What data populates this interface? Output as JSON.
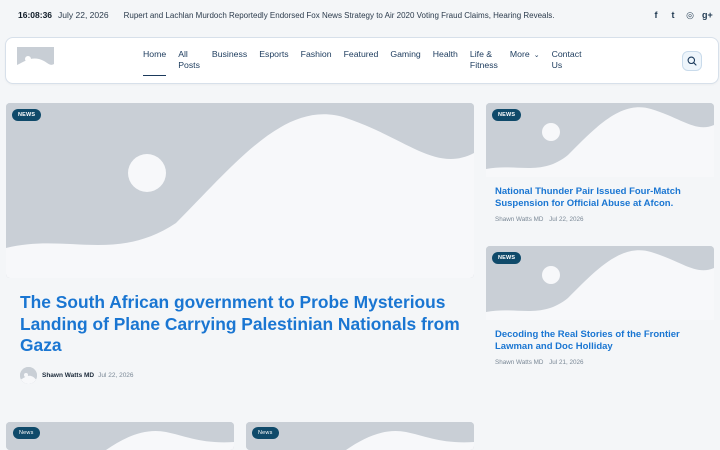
{
  "topbar": {
    "time": "16:08:36",
    "date": "July 22, 2026",
    "ticker": "Rupert and Lachlan Murdoch Reportedly Endorsed Fox News Strategy to Air 2020 Voting Fraud Claims, Hearing Reveals.",
    "social": [
      {
        "icon": "facebook-icon",
        "glyph": "f"
      },
      {
        "icon": "twitter-icon",
        "glyph": "t"
      },
      {
        "icon": "instagram-icon",
        "glyph": "◎"
      },
      {
        "icon": "google-plus-icon",
        "glyph": "g+"
      }
    ]
  },
  "header": {
    "nav": [
      {
        "label": "Home",
        "line2": ""
      },
      {
        "label": "All",
        "line2": "Posts"
      },
      {
        "label": "Business",
        "line2": ""
      },
      {
        "label": "Esports",
        "line2": ""
      },
      {
        "label": "Fashion",
        "line2": ""
      },
      {
        "label": "Featured",
        "line2": ""
      },
      {
        "label": "Gaming",
        "line2": ""
      },
      {
        "label": "Health",
        "line2": ""
      },
      {
        "label": "Life &",
        "line2": "Fitness"
      },
      {
        "label": "More",
        "line2": ""
      },
      {
        "label": "Contact",
        "line2": "Us"
      }
    ]
  },
  "featured": {
    "badge": "NEWS",
    "title": "The South African government to Probe Mysterious Landing of Plane Carrying Palestinian Nationals from Gaza",
    "author": "Shawn Watts MD",
    "date": "Jul 22, 2026"
  },
  "side": [
    {
      "badge": "NEWS",
      "title": "National Thunder Pair Issued Four-Match Suspension for Official Abuse at Afcon.",
      "author": "Shawn Watts MD",
      "date": "Jul 22, 2026"
    },
    {
      "badge": "NEWS",
      "title": "Decoding the Real Stories of the Frontier Lawman and Doc Holliday",
      "author": "Shawn Watts MD",
      "date": "Jul 21, 2026"
    }
  ],
  "bottom": [
    {
      "badge": "News"
    },
    {
      "badge": "News"
    }
  ],
  "colors": {
    "accent": "#1a76d2",
    "badge_bg": "#0f4a6a",
    "placeholder": "#c9cfd6"
  }
}
